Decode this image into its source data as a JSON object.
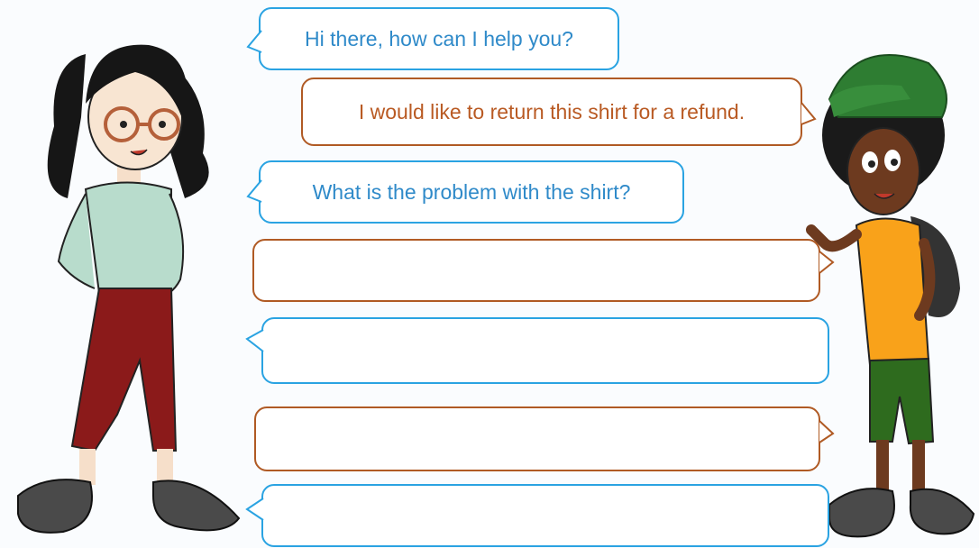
{
  "dialogue": [
    {
      "speaker": "shop-assistant",
      "text": "Hi there, how can I help you?"
    },
    {
      "speaker": "customer",
      "text": "I would like to return this shirt for a refund."
    },
    {
      "speaker": "shop-assistant",
      "text": "What is the problem with the shirt?"
    },
    {
      "speaker": "customer",
      "text": ""
    },
    {
      "speaker": "shop-assistant",
      "text": ""
    },
    {
      "speaker": "customer",
      "text": ""
    },
    {
      "speaker": "shop-assistant",
      "text": ""
    }
  ],
  "colors": {
    "assistant_bubble": "#2aa3e2",
    "customer_bubble": "#b05a24",
    "background": "#fafcfe"
  }
}
